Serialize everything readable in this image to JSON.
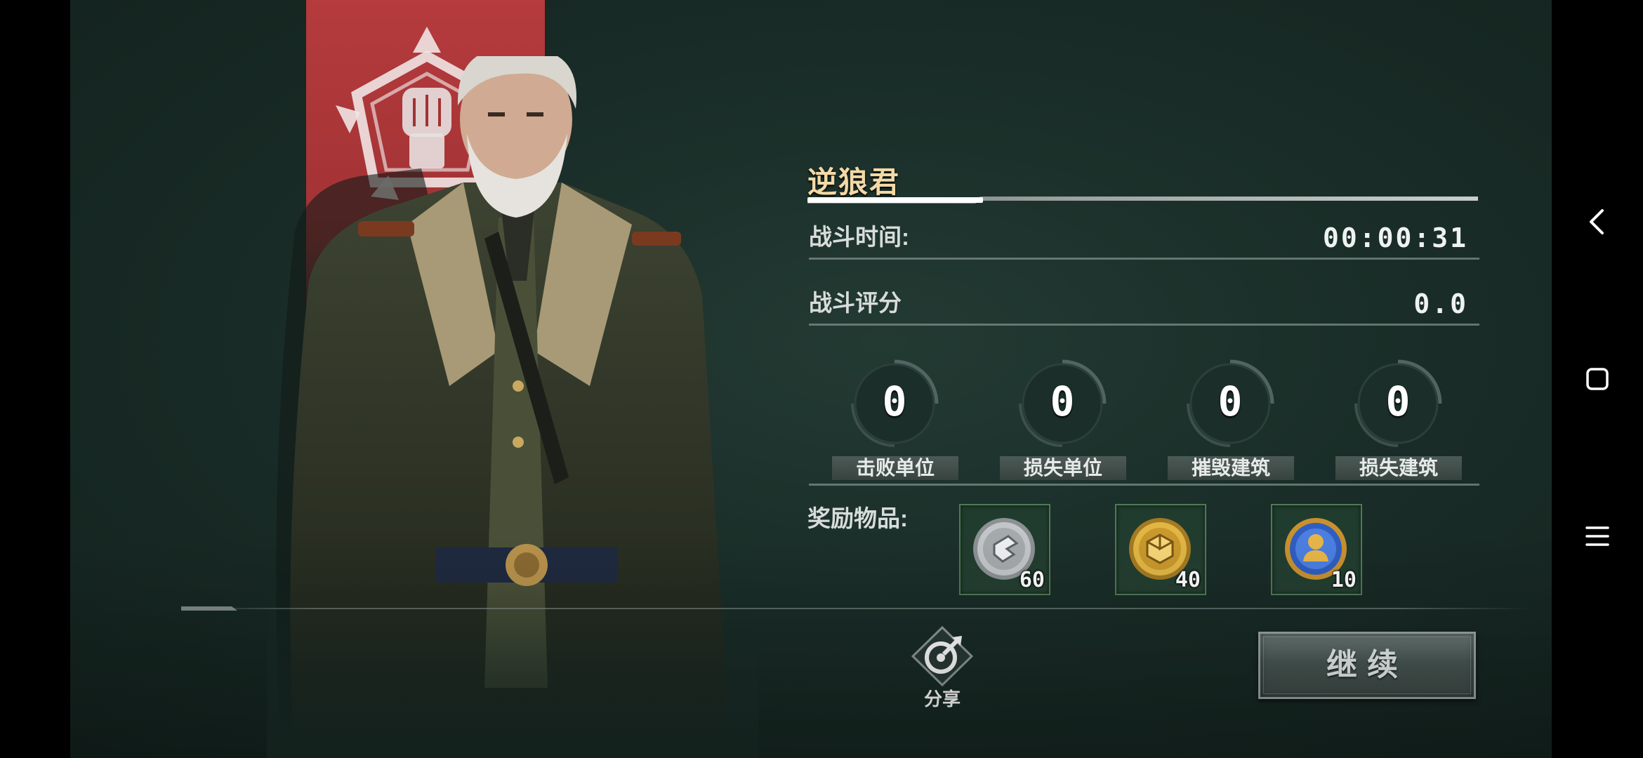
{
  "player_name": "逆狼君",
  "stats": {
    "battle_time_label": "战斗时间:",
    "battle_time_value": "00:00:31",
    "battle_score_label": "战斗评分",
    "battle_score_value": "0.0"
  },
  "counters": [
    {
      "label": "击败单位",
      "value": "0"
    },
    {
      "label": "损失单位",
      "value": "0"
    },
    {
      "label": "摧毁建筑",
      "value": "0"
    },
    {
      "label": "损失建筑",
      "value": "0"
    }
  ],
  "rewards": {
    "label": "奖励物品:",
    "items": [
      {
        "icon": "silver-coin-icon",
        "count": "60"
      },
      {
        "icon": "gold-coin-icon",
        "count": "40"
      },
      {
        "icon": "commander-medal-icon",
        "count": "10"
      }
    ]
  },
  "share_label": "分享",
  "continue_label": "继续",
  "colors": {
    "background": "#1a2d28",
    "banner_red": "#b53b3d",
    "title_gold": "#f2d9a6"
  },
  "nav": {
    "back": "back-icon",
    "home": "home-icon",
    "menu": "menu-icon"
  }
}
